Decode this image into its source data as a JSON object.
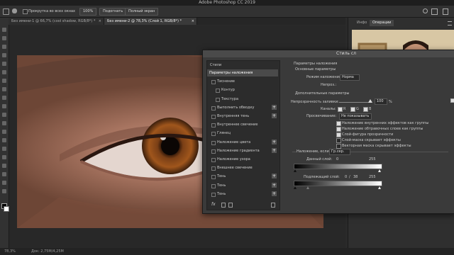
{
  "app": {
    "title": "Adobe Photoshop CC 2019"
  },
  "options_bar": {
    "checkbox_label": "Прокрутка во всех окнах",
    "zoom_value": "100%",
    "fit_label": "Подогнать",
    "fullscreen_label": "Полный экран"
  },
  "doc_tabs": [
    {
      "label": "Без имени-1 @ 66,7% (cool shadow, RGB/8*) *",
      "close": "×"
    },
    {
      "label": "Без имени-2 @ 78,3% (Слой 1, RGB/8*) *",
      "close": "×"
    }
  ],
  "right_panel": {
    "tab_info": "Инфо",
    "tab_actions": "Операции"
  },
  "dialog": {
    "title": "Стиль сл",
    "styles_header": "Стили",
    "style_items": [
      {
        "label": "Параметры наложения",
        "has_check": false,
        "has_plus": false,
        "selected": true
      },
      {
        "label": "Тиснение",
        "has_check": true,
        "has_plus": false
      },
      {
        "label": "Контур",
        "has_check": true,
        "has_plus": false,
        "indent": true
      },
      {
        "label": "Текстура",
        "has_check": true,
        "has_plus": false,
        "indent": true
      },
      {
        "label": "Выполнить обводку",
        "has_check": true,
        "has_plus": true
      },
      {
        "label": "Внутренняя тень",
        "has_check": true,
        "has_plus": true
      },
      {
        "label": "Внутреннее свечение",
        "has_check": true,
        "has_plus": false
      },
      {
        "label": "Глянец",
        "has_check": true,
        "has_plus": false
      },
      {
        "label": "Наложение цвета",
        "has_check": true,
        "has_plus": true
      },
      {
        "label": "Наложение градиента",
        "has_check": true,
        "has_plus": true
      },
      {
        "label": "Наложение узора",
        "has_check": true,
        "has_plus": false
      },
      {
        "label": "Внешнее свечение",
        "has_check": true,
        "has_plus": false
      },
      {
        "label": "Тень",
        "has_check": true,
        "has_plus": true
      },
      {
        "label": "Тень",
        "has_check": true,
        "has_plus": true
      },
      {
        "label": "Тень",
        "has_check": true,
        "has_plus": true
      }
    ],
    "fx_label": "fx",
    "blend": {
      "section_title": "Параметры наложения",
      "general_title": "Основные параметры",
      "mode_label": "Режим наложения:",
      "mode_value": "Норма",
      "opacity_label": "Непроз.:",
      "advanced_title": "Дополнительные параметры",
      "fill_label": "Непрозрачность заливки:",
      "fill_value": "100",
      "fill_unit": "%",
      "channels_label": "Каналы:",
      "channels": [
        "R",
        "G",
        "B"
      ],
      "knockout_label": "Просвечивание:",
      "knockout_value": "Не показывать",
      "checks": [
        "Наложение внутренних эффектов как группы",
        "Наложение обтравочных слоев как группы",
        "Слой-фигура прозрачности",
        "Слой-маска скрывает эффекты",
        "Векторная маска скрывает эффекты"
      ],
      "blendif_label": "Наложение, если:",
      "blendif_value": "Гр.сер.",
      "this_layer_label": "Данный слой:",
      "this_layer_min": "0",
      "this_layer_max": "255",
      "under_layer_label": "Подлежащий слой:",
      "under_layer_min": "0",
      "under_layer_split": "38",
      "under_layer_max": "255"
    }
  },
  "status": {
    "zoom": "78,3%",
    "doc": "Док: 2,75М/4,25М"
  },
  "colors": {
    "accent": "#4a90d9",
    "panel": "#3a3a3a"
  }
}
